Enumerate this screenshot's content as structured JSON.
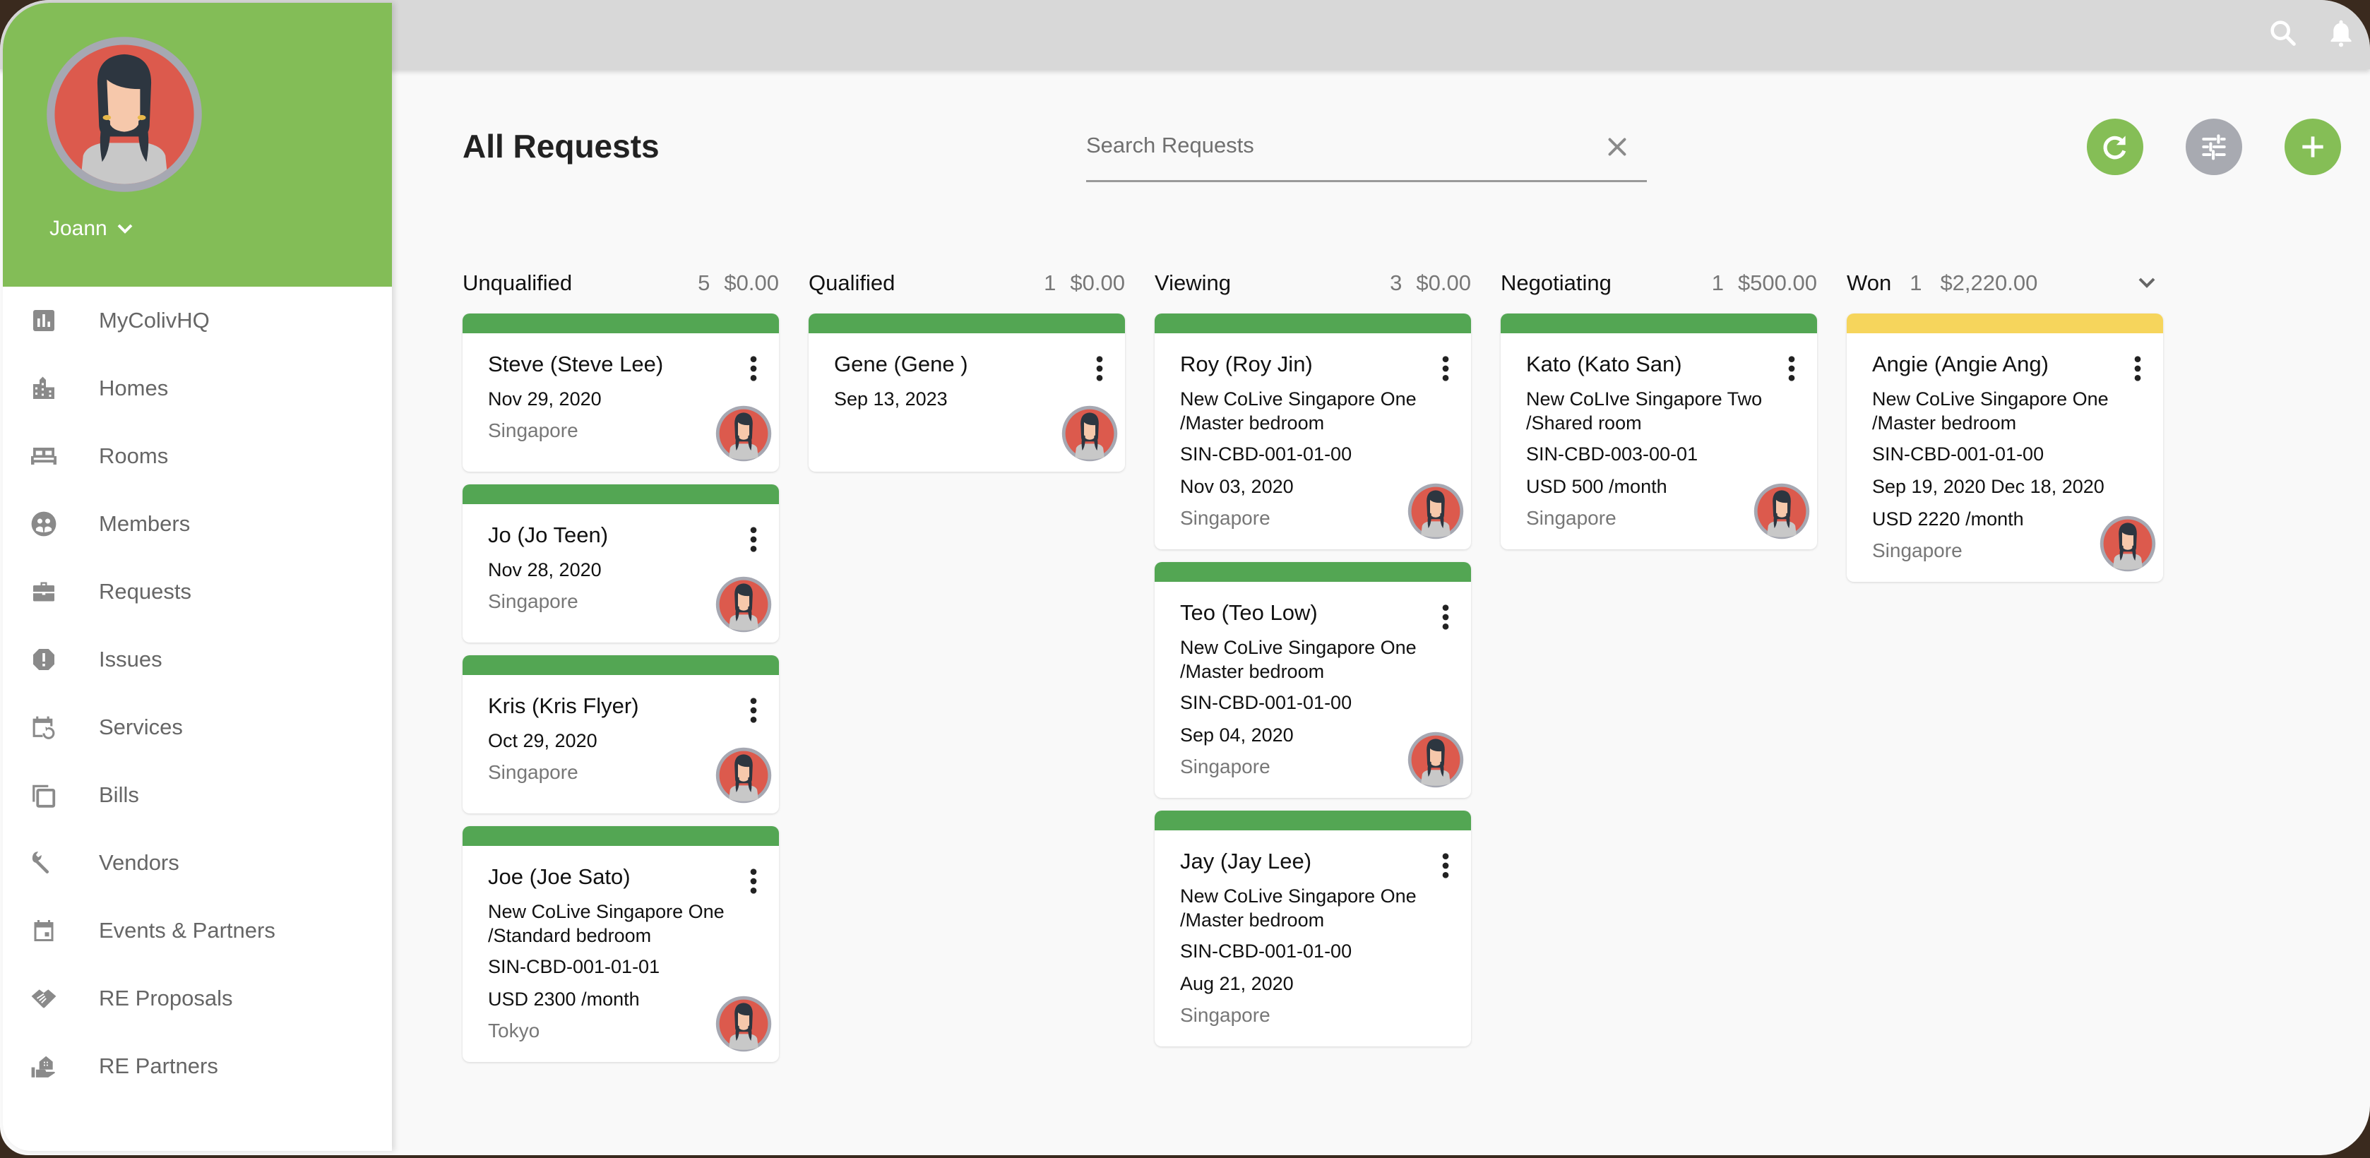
{
  "topbar": {
    "icons": [
      "search-icon",
      "bell-icon"
    ]
  },
  "user": {
    "name": "Joann"
  },
  "sidebar": {
    "items": [
      {
        "label": "MyColivHQ",
        "icon": "bar-chart-icon"
      },
      {
        "label": "Homes",
        "icon": "building-icon"
      },
      {
        "label": "Rooms",
        "icon": "bed-icon"
      },
      {
        "label": "Members",
        "icon": "people-icon"
      },
      {
        "label": "Requests",
        "icon": "briefcase-icon"
      },
      {
        "label": "Issues",
        "icon": "alert-octagon-icon"
      },
      {
        "label": "Services",
        "icon": "calendar-repeat-icon"
      },
      {
        "label": "Bills",
        "icon": "copy-icon"
      },
      {
        "label": "Vendors",
        "icon": "wrench-icon"
      },
      {
        "label": "Events & Partners",
        "icon": "calendar-event-icon"
      },
      {
        "label": "RE Proposals",
        "icon": "handshake-icon"
      },
      {
        "label": "RE Partners",
        "icon": "hand-house-icon"
      }
    ]
  },
  "page": {
    "title": "All Requests",
    "search_placeholder": "Search Requests",
    "search_value": ""
  },
  "actions": {
    "refresh": "refresh-icon",
    "filter": "tune-icon",
    "add": "plus-icon"
  },
  "colors": {
    "brand_green": "#83bd57",
    "stripe_green": "#53a653",
    "stripe_yellow": "#f6d55c",
    "fab_gray": "#a8aab1"
  },
  "columns": [
    {
      "title": "Unqualified",
      "count": "5",
      "amount": "$0.00",
      "cards": [
        {
          "name": "Steve (Steve Lee)",
          "date": "Nov 29, 2020",
          "city": "Singapore",
          "stripe": "green"
        },
        {
          "name": "Jo (Jo Teen)",
          "date": "Nov 28, 2020",
          "city": "Singapore",
          "stripe": "green"
        },
        {
          "name": "Kris (Kris Flyer)",
          "date": "Oct 29, 2020",
          "city": "Singapore",
          "stripe": "green"
        },
        {
          "name": "Joe (Joe Sato)",
          "property": "New CoLive Singapore One /Standard bedroom",
          "room": "SIN-CBD-001-01-01",
          "price": "USD 2300 /month",
          "city": "Tokyo",
          "stripe": "green"
        }
      ]
    },
    {
      "title": "Qualified",
      "count": "1",
      "amount": "$0.00",
      "cards": [
        {
          "name": "Gene (Gene )",
          "date": "Sep 13, 2023",
          "stripe": "green"
        }
      ]
    },
    {
      "title": "Viewing",
      "count": "3",
      "amount": "$0.00",
      "cards": [
        {
          "name": "Roy (Roy Jin)",
          "property": "New CoLive Singapore One /Master bedroom",
          "room": "SIN-CBD-001-01-00",
          "date": "Nov 03, 2020",
          "city": "Singapore",
          "stripe": "green"
        },
        {
          "name": "Teo (Teo Low)",
          "property": "New CoLive Singapore One /Master bedroom",
          "room": "SIN-CBD-001-01-00",
          "date": "Sep 04, 2020",
          "city": "Singapore",
          "stripe": "green"
        },
        {
          "name": "Jay (Jay Lee)",
          "property": "New CoLive Singapore One /Master bedroom",
          "room": "SIN-CBD-001-01-00",
          "date": "Aug 21, 2020",
          "city": "Singapore",
          "stripe": "green",
          "no_avatar": true
        }
      ]
    },
    {
      "title": "Negotiating",
      "count": "1",
      "amount": "$500.00",
      "cards": [
        {
          "name": "Kato (Kato San)",
          "property": "New CoLIve Singapore Two /Shared room",
          "room": "SIN-CBD-003-00-01",
          "price": "USD 500 /month",
          "city": "Singapore",
          "stripe": "green"
        }
      ]
    },
    {
      "title": "Won",
      "count": "1",
      "amount": "$2,220.00",
      "cards": [
        {
          "name": "Angie (Angie Ang)",
          "property": "New CoLive Singapore One /Master bedroom",
          "room": "SIN-CBD-001-01-00",
          "date": "Sep 19, 2020  Dec 18, 2020",
          "price": "USD 2220 /month",
          "city": "Singapore",
          "stripe": "yellow"
        }
      ]
    }
  ]
}
